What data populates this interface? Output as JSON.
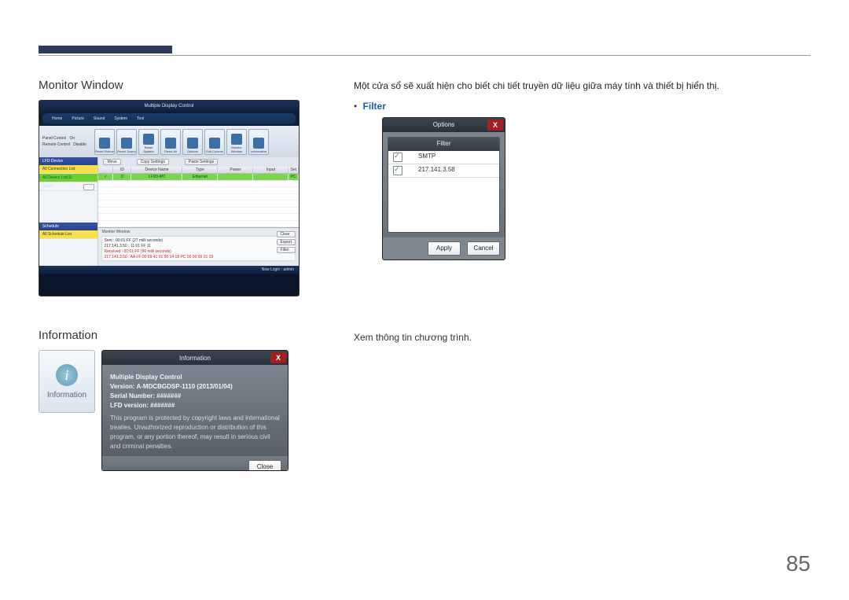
{
  "page_number": "85",
  "section1": {
    "heading": "Monitor Window",
    "desc": "Một cửa sổ sẽ xuất hiện cho biết chi tiết truyền dữ liệu giữa máy tính và thiết bị hiển thị.",
    "bullet_label": "Filter"
  },
  "section2": {
    "heading": "Information",
    "desc": "Xem thông tin chương trình."
  },
  "app": {
    "title": "Multiple Display Control",
    "menu": [
      "Home",
      "Picture",
      "Sound",
      "System",
      "Tool"
    ],
    "toolbar_left": {
      "l1": "Panel Control",
      "v1": "On",
      "l2": "Remote Control",
      "v2": "Disable"
    },
    "toolbar_icons": [
      "Reset Picture",
      "Reset Sound",
      "Reset System",
      "Reset All",
      "Options",
      "Edit Column",
      "Monitor Window",
      "Information"
    ],
    "top_buttons": [
      "Move",
      "Copy Settings",
      "Paste Settings"
    ],
    "sidebar": {
      "lfd_header": "LFD Device",
      "all_conn": "All Connection List",
      "all_device": "All Device List(1)",
      "group": "Group",
      "edit": "Edit",
      "schedule_header": "Schedule",
      "all_schedule": "All Schedule List"
    },
    "grid": {
      "headers": [
        "",
        "ID",
        "Device Name",
        "Type",
        "Power",
        "Input",
        "Set"
      ],
      "row": {
        "id": "0",
        "name": "LFD0-IP0",
        "type": "Ethernet",
        "power": "",
        "input": "",
        "set": "PC"
      }
    },
    "monitor": {
      "title": "Monitor Window",
      "line1": "Sent : 00:01:FF (27 milli seconds)",
      "line2": "217.141.3.50 : 11 01 FF 11",
      "line3": "Received : 00:01:FF (96 milli seconds)",
      "line4": "217.141.3.50 : AA FF 00 09 41 01 00 14 18 PC 00 00 00 01 19",
      "btns": [
        "Clear",
        "Export",
        "Filter"
      ]
    },
    "status": "Now Login : admin"
  },
  "options_popup": {
    "title": "Options",
    "list_header": "Filter",
    "rows": [
      "SMTP",
      "217.141.3.58"
    ],
    "apply": "Apply",
    "cancel": "Cancel"
  },
  "info_tile": {
    "label": "Information"
  },
  "info_dialog": {
    "title": "Information",
    "line1": "Multiple Display Control",
    "line2": "Version: A-MDCBGDSP-1110 (2013/01/04)",
    "line3": "Serial Number: #######",
    "line4": "LFD version: #######",
    "para": "This program is protected by copyright laws and international treaties. Unauthorized reproduction or distribution of this program, or any portion thereof, may result in serious civil and criminal penalties.",
    "close": "Close"
  }
}
